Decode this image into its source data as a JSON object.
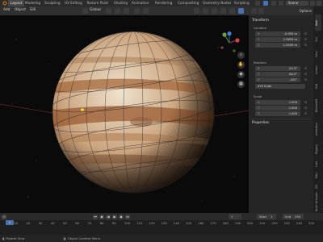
{
  "app": {
    "workspace_tabs": [
      "Layout",
      "Modeling",
      "Sculpting",
      "UV Editing",
      "Texture Paint",
      "Shading",
      "Animation",
      "Rendering",
      "Compositing",
      "Geometry Nodes",
      "Scripting"
    ],
    "active_tab": "Layout",
    "scene_name": "Scene"
  },
  "header": {
    "menus": [
      "Add",
      "Object",
      "GIS"
    ],
    "transform_orientation": "Global"
  },
  "sidebar": {
    "options_label": "Options",
    "transform_title": "Transform",
    "location_label": "Location",
    "location": [
      {
        "axis": "X",
        "value": "-0.092 m"
      },
      {
        "axis": "Y",
        "value": "2.0859 m"
      },
      {
        "axis": "Z",
        "value": "1.0039 m"
      }
    ],
    "rotation_label": "Rotation",
    "rotation": [
      {
        "axis": "X",
        "value": "-25.3°"
      },
      {
        "axis": "Y",
        "value": "84.2°"
      },
      {
        "axis": "Z",
        "value": "-101°"
      }
    ],
    "rotation_mode": "XYZ Euler",
    "scale_label": "Scale",
    "scale": [
      {
        "axis": "X",
        "value": "1.000"
      },
      {
        "axis": "Y",
        "value": "1.000"
      },
      {
        "axis": "Z",
        "value": "1.000"
      }
    ],
    "properties_title": "Properties",
    "vertical_tabs": [
      "Item",
      "Tool",
      "View",
      "Create",
      "Edit",
      "BlenderKit",
      "Animation",
      "Rigging",
      "Cam",
      "Misc",
      "GIS",
      "Node Wrangler"
    ]
  },
  "timeline": {
    "menus": [
      "Playback",
      "Keying",
      "View",
      "Marker"
    ],
    "current_frame": "1",
    "start_label": "Start",
    "start": "1",
    "end_label": "End",
    "end": "250",
    "ticks": [
      "0",
      "10",
      "20",
      "30",
      "40",
      "50",
      "60",
      "70",
      "80",
      "90",
      "100",
      "110",
      "120",
      "130",
      "140",
      "150",
      "160",
      "170",
      "180",
      "190",
      "200",
      "210",
      "220",
      "230",
      "240",
      "250"
    ],
    "playhead": "1"
  },
  "statusbar": {
    "hints": [
      "Select",
      "Rotate View",
      "Object Context Menu"
    ]
  },
  "colors": {
    "accent": "#4772b3",
    "background": "#0a0a0a",
    "planet_base": "#c8a27a"
  }
}
